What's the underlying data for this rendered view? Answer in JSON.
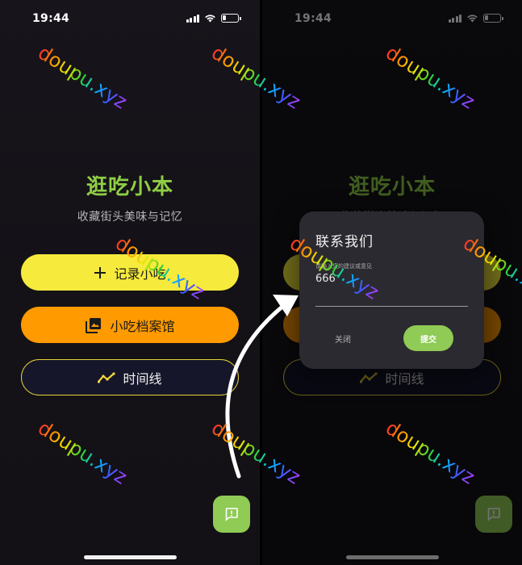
{
  "status_bar": {
    "time": "19:44"
  },
  "home": {
    "title": "逛吃小本",
    "subtitle": "收藏街头美味与记忆",
    "buttons": {
      "record": "记录小吃",
      "archive": "小吃档案馆",
      "timeline": "时间线"
    },
    "fab_icon": "feedback-icon"
  },
  "dialog": {
    "title": "联系我们",
    "hint": "请输入您的建议或意见",
    "input_value": "666",
    "cancel": "关闭",
    "submit": "提交"
  },
  "watermark": {
    "text": "doupu.xyz"
  },
  "colors": {
    "title_green": "#8fce45",
    "record_yellow": "#f6ea3c",
    "archive_orange": "#ff9a00",
    "timeline_border": "#e6d23a",
    "fab_green": "#8fcb55",
    "dialog_bg": "#2b2a30",
    "background": "#141217"
  }
}
